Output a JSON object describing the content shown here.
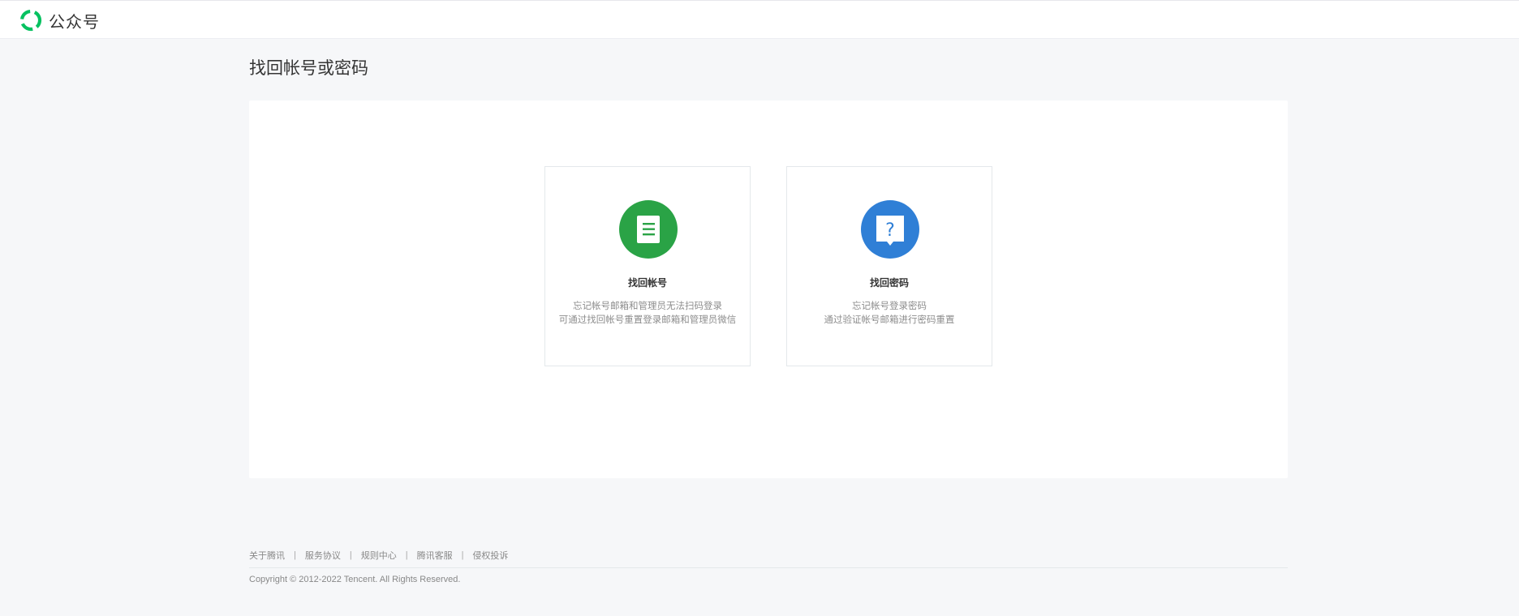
{
  "header": {
    "brand_label": "公众号",
    "logo_icon": "wechat-official-account-logo",
    "logo_color": "#07c160"
  },
  "page": {
    "title": "找回帐号或密码"
  },
  "cards": {
    "account": {
      "icon": "document-icon",
      "icon_color": "#2aa346",
      "title": "找回帐号",
      "desc_line1": "忘记帐号邮箱和管理员无法扫码登录",
      "desc_line2": "可通过找回帐号重置登录邮箱和管理员微信"
    },
    "password": {
      "icon": "question-bubble-icon",
      "icon_color": "#2f7fd6",
      "title": "找回密码",
      "desc_line1": "忘记帐号登录密码",
      "desc_line2": "通过验证帐号邮箱进行密码重置"
    }
  },
  "footer": {
    "links": [
      "关于腾讯",
      "服务协议",
      "规则中心",
      "腾讯客服",
      "侵权投诉"
    ],
    "separator": "|",
    "copyright": "Copyright © 2012-2022 Tencent. All Rights Reserved."
  }
}
